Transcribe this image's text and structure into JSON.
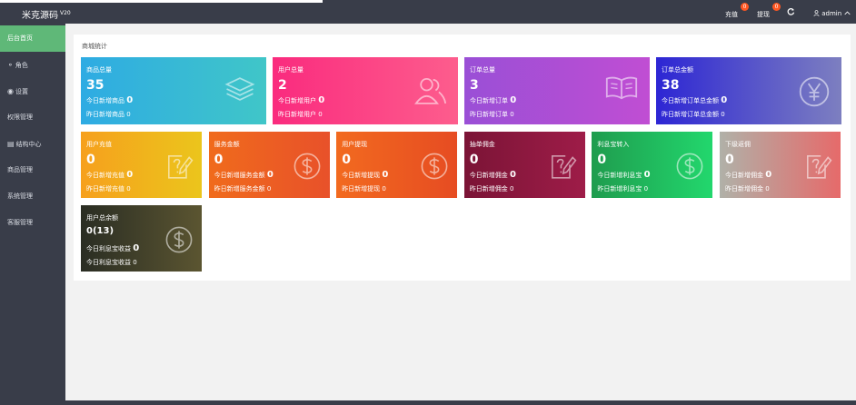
{
  "header": {
    "brand": "米克源码",
    "brand_version": "V20",
    "recharge_label": "充值",
    "recharge_badge": "0",
    "withdraw_label": "提现",
    "withdraw_badge": "0",
    "user_label": "admin"
  },
  "sidebar": {
    "items": [
      {
        "label": "后台首页",
        "icon": "",
        "active": true
      },
      {
        "label": "角色",
        "icon": "user-icon"
      },
      {
        "label": "设置",
        "icon": "globe-icon"
      },
      {
        "label": "权限管理",
        "icon": ""
      },
      {
        "label": "结构中心",
        "icon": "id-card-icon"
      },
      {
        "label": "商品管理",
        "icon": ""
      },
      {
        "label": "系统管理",
        "icon": ""
      },
      {
        "label": "客服管理",
        "icon": ""
      }
    ]
  },
  "panel": {
    "title": "商城统计"
  },
  "cards_row1": [
    {
      "title": "商品总量",
      "number": "35",
      "l1_label": "今日新增商品",
      "l1_value": "0",
      "l2_label": "昨日新增商品",
      "l2_value": "0",
      "icon": "layers-icon",
      "gradient": [
        "#2eabe3",
        "#40c6c8"
      ]
    },
    {
      "title": "用户总量",
      "number": "2",
      "l1_label": "今日新增用户",
      "l1_value": "0",
      "l2_label": "昨日新增用户",
      "l2_value": "0",
      "icon": "users-icon",
      "gradient": [
        "#fa2b7e",
        "#fd5d8d"
      ]
    },
    {
      "title": "订单总量",
      "number": "3",
      "l1_label": "今日新增订单",
      "l1_value": "0",
      "l2_label": "昨日新增订单",
      "l2_value": "0",
      "icon": "book-icon",
      "gradient": [
        "#9a4fd6",
        "#c04ed3"
      ]
    },
    {
      "title": "订单总金额",
      "number": "38",
      "l1_label": "今日新增订单总金额",
      "l1_value": "0",
      "l2_label": "昨日新增订单总金额",
      "l2_value": "0",
      "icon": "yen-icon",
      "gradient": [
        "#2d26d4",
        "#7d7fc0"
      ]
    }
  ],
  "cards_row2": [
    {
      "title": "用户充值",
      "number": "0",
      "l1_label": "今日新增充值",
      "l1_value": "0",
      "l2_label": "昨日新增充值",
      "l2_value": "0",
      "icon": "edit-note-icon",
      "gradient": [
        "#f6a01d",
        "#ebc51c"
      ]
    },
    {
      "title": "服务金额",
      "number": "0",
      "l1_label": "今日新增服务金额",
      "l1_value": "0",
      "l2_label": "昨日新增服务金额",
      "l2_value": "0",
      "icon": "dollar-icon",
      "gradient": [
        "#f06b1c",
        "#e8512a"
      ]
    },
    {
      "title": "用户提现",
      "number": "0",
      "l1_label": "今日新增提现",
      "l1_value": "0",
      "l2_label": "昨日新增提现",
      "l2_value": "0",
      "icon": "dollar-icon",
      "gradient": [
        "#f26a1f",
        "#e64c22"
      ]
    },
    {
      "title": "抽单佣金",
      "number": "0",
      "l1_label": "今日新增佣金",
      "l1_value": "0",
      "l2_label": "昨日新增佣金",
      "l2_value": "0",
      "icon": "edit-note-icon",
      "gradient": [
        "#7b1436",
        "#9e1c48"
      ]
    },
    {
      "title": "利息宝转入",
      "number": "0",
      "l1_label": "今日新增利息宝",
      "l1_value": "0",
      "l2_label": "昨日新增利息宝",
      "l2_value": "0",
      "icon": "dollar-icon",
      "gradient": [
        "#1f9c4e",
        "#22d76d"
      ]
    },
    {
      "title": "下级返佣",
      "number": "0",
      "l1_label": "今日新增佣金",
      "l1_value": "0",
      "l2_label": "昨日新增佣金",
      "l2_value": "0",
      "icon": "edit-note-icon",
      "gradient": [
        "#b0b1a8",
        "#e66a6a"
      ]
    }
  ],
  "cards_row3": [
    {
      "title": "用户总余额",
      "number": "0(13)",
      "l1_label": "今日利息宝收益",
      "l1_value": "0",
      "l2_label": "今日利息宝收益",
      "l2_value": "0",
      "icon": "dollar-icon",
      "gradient": [
        "#2a2d23",
        "#5b5531"
      ]
    }
  ]
}
